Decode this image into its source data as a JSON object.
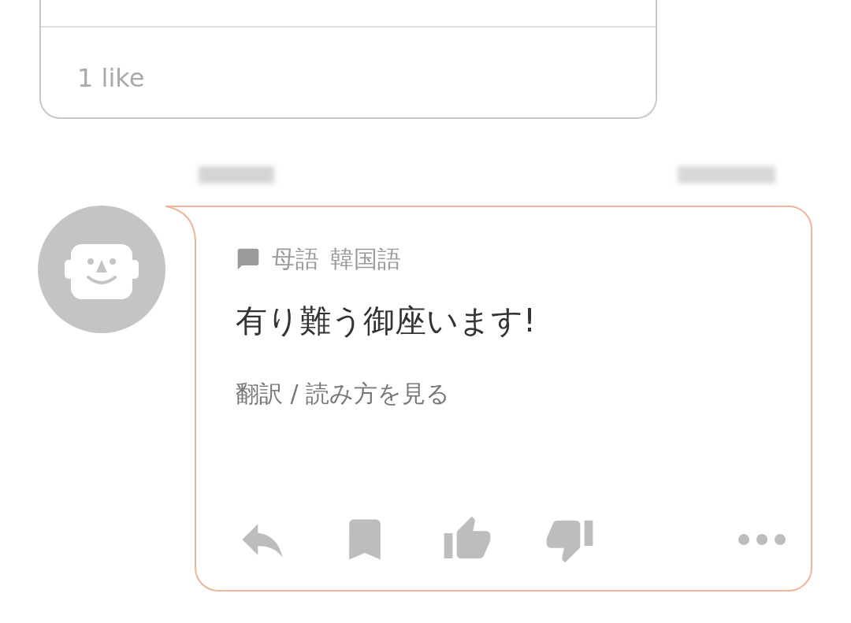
{
  "previous_card": {
    "likes": "1 like"
  },
  "post": {
    "native_language_label": "母語",
    "native_language": "韓国語",
    "message": "有り難う御座います!",
    "translate_link": "翻訳 / 読み方を見る"
  }
}
